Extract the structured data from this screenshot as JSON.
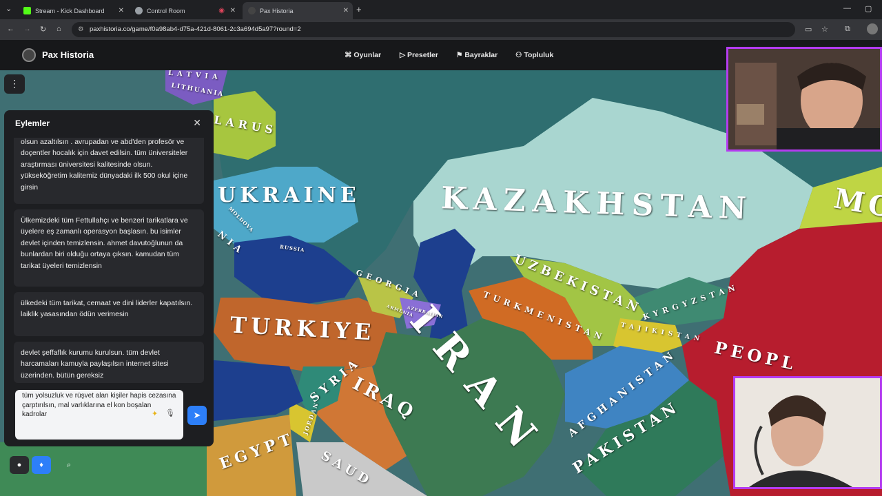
{
  "browser": {
    "tabs": [
      {
        "title": "Stream - Kick Dashboard",
        "favicon_color": "#53fc18"
      },
      {
        "title": "Control Room",
        "favicon_color": "#9aa0a6"
      },
      {
        "title": "Pax Historia",
        "favicon_color": "#444444"
      }
    ],
    "url": "paxhistoria.co/game/f0a98ab4-d75a-421d-8061-2c3a694d5a97?round=2"
  },
  "header": {
    "brand": "Pax Historia",
    "nav": [
      "Oyunlar",
      "Presetler",
      "Bayraklar",
      "Topluluk"
    ]
  },
  "panel": {
    "title": "Eylemler",
    "messages": [
      "olsun azaltılsın . avrupadan ve abd'den profesör ve doçentler hocalık için davet edilsin. tüm üniversiteler araştırması üniversitesi kalitesinde olsun. yükseköğretim kalitemiz dünyadaki ilk 500 okul içine girsin",
      "Ülkemizdeki tüm Fettullahçı ve benzeri tarikatlara ve üyelere eş zamanlı operasyon başlasın. bu isimler devlet içinden temizlensin. ahmet davutoğlunun da bunlardan biri olduğu ortaya çıksın. kamudan tüm tarikat üyeleri temizlensin",
      "ülkedeki tüm tarikat, cemaat ve dini liderler kapatılsın. laiklik yasasından ödün verimesin",
      "devlet şeffaflık kurumu kurulsun. tüm devlet harcamaları kamuyla paylaşılsın internet sitesi üzerinden. bütün gereksiz"
    ],
    "composer_text": "tüm yolsuzluk ve rüşvet alan kişiler hapis cezasına çarptırılsın, mal varlıklarına el kon boşalan kadrolar"
  },
  "map": {
    "labels": [
      "KAZAKHSTAN",
      "UKRAINE",
      "TURKIYE",
      "IRAN",
      "UZBEKISTAN",
      "TURKMENISTAN",
      "KYRGYZSTAN",
      "TAJIKISTAN",
      "AFGHANISTAN",
      "PAKISTAN",
      "IRAQ",
      "SYRIA",
      "GEORGIA",
      "ARMENIA",
      "AZERBAIJAN",
      "JORDAN",
      "EGYPT",
      "SAUD",
      "PEOPL",
      "MO",
      "LARUS",
      "LATVIA",
      "LITHUANIA",
      "NIA",
      "MOLDOVA",
      "RUSSIA"
    ]
  }
}
